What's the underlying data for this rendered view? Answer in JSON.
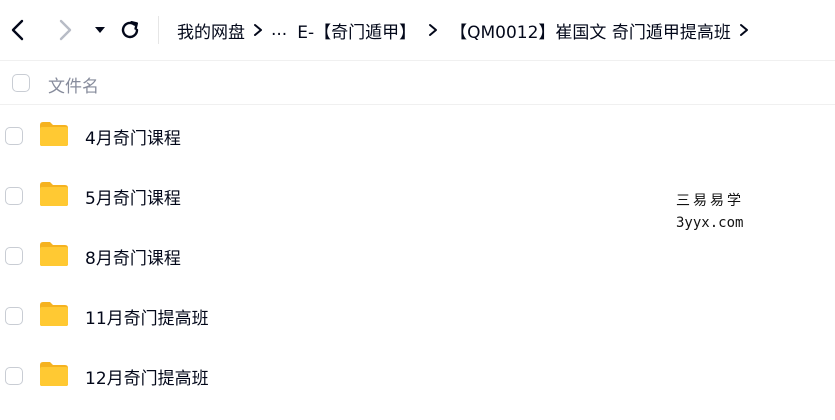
{
  "toolbar": {
    "back_icon": "chevron-left-icon",
    "forward_icon": "chevron-right-icon",
    "dropdown_icon": "caret-down-icon",
    "refresh_icon": "refresh-icon"
  },
  "breadcrumb": {
    "items": [
      "我的网盘",
      "...",
      "E-【奇门遁甲】",
      "【QM0012】崔国文 奇门遁甲提高班"
    ],
    "separator_icon": "chevron-right-icon"
  },
  "file_list": {
    "header_label": "文件名",
    "rows": [
      {
        "name": "4月奇门课程",
        "icon": "folder-icon"
      },
      {
        "name": "5月奇门课程",
        "icon": "folder-icon"
      },
      {
        "name": "8月奇门课程",
        "icon": "folder-icon"
      },
      {
        "name": "11月奇门提高班",
        "icon": "folder-icon"
      },
      {
        "name": "12月奇门提高班",
        "icon": "folder-icon"
      }
    ]
  },
  "watermark": {
    "line1": "三易易学",
    "line2": "3yyx.com"
  },
  "colors": {
    "text": "#03081a",
    "muted": "#878c9c",
    "folder": "#ffc933",
    "folder_back": "#f5b21f",
    "disabled": "#b8bcc6"
  }
}
